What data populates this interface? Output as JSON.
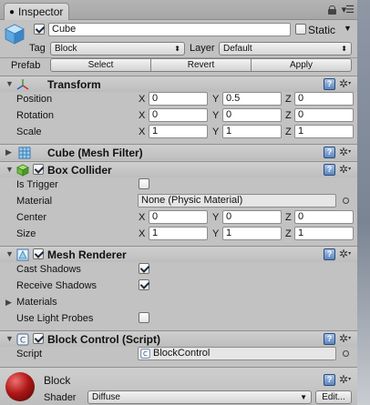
{
  "tab": {
    "icon": "info-icon",
    "label": "Inspector"
  },
  "object": {
    "active": true,
    "name": "Cube",
    "static_label": "Static",
    "static": false,
    "tag_label": "Tag",
    "tag_value": "Block",
    "layer_label": "Layer",
    "layer_value": "Default",
    "prefab_label": "Prefab",
    "prefab_buttons": [
      "Select",
      "Revert",
      "Apply"
    ]
  },
  "transform": {
    "title": "Transform",
    "rows": [
      {
        "label": "Position",
        "x": "0",
        "y": "0.5",
        "z": "0"
      },
      {
        "label": "Rotation",
        "x": "0",
        "y": "0",
        "z": "0"
      },
      {
        "label": "Scale",
        "x": "1",
        "y": "1",
        "z": "1"
      }
    ]
  },
  "mesh_filter": {
    "title": "Cube (Mesh Filter)"
  },
  "box_collider": {
    "title": "Box Collider",
    "enabled": true,
    "is_trigger_label": "Is Trigger",
    "is_trigger": false,
    "material_label": "Material",
    "material_value": "None (Physic Material)",
    "center": {
      "label": "Center",
      "x": "0",
      "y": "0",
      "z": "0"
    },
    "size": {
      "label": "Size",
      "x": "1",
      "y": "1",
      "z": "1"
    }
  },
  "mesh_renderer": {
    "title": "Mesh Renderer",
    "enabled": true,
    "cast_shadows_label": "Cast Shadows",
    "cast_shadows": true,
    "receive_shadows_label": "Receive Shadows",
    "receive_shadows": true,
    "materials_label": "Materials",
    "light_probes_label": "Use Light Probes",
    "light_probes": false
  },
  "script": {
    "title": "Block Control (Script)",
    "enabled": true,
    "script_label": "Script",
    "script_value": "BlockControl"
  },
  "material": {
    "name": "Block",
    "shader_label": "Shader",
    "shader_value": "Diffuse",
    "edit_label": "Edit..."
  },
  "axis_labels": [
    "X",
    "Y",
    "Z"
  ],
  "colors": {
    "panel_bg": "#c2c2c2",
    "help_icon": "#5e86bf",
    "material_ball": "#b01818"
  }
}
